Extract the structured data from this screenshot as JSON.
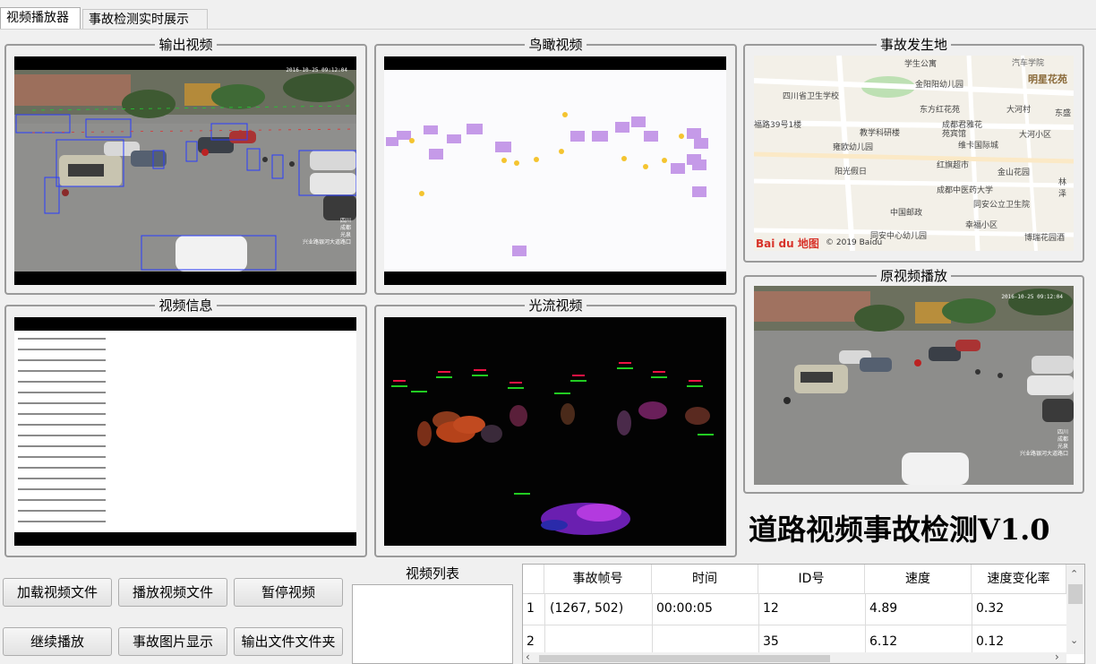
{
  "tabs": [
    {
      "label": "视频播放器",
      "active": true
    },
    {
      "label": "事故检测实时展示",
      "active": false
    }
  ],
  "panels": {
    "output_video": "输出视频",
    "birdseye_video": "鸟瞰视频",
    "accident_location": "事故发生地",
    "video_info": "视频信息",
    "optical_flow": "光流视频",
    "original_video": "原视频播放"
  },
  "frame_overlay": {
    "timestamp": "2016-10-25 09:12:04",
    "location_lines": [
      "四川",
      "成都",
      "光泉",
      "兴业路银河大道路口"
    ]
  },
  "map": {
    "labels": [
      "学生公寓",
      "汽车学院",
      "明星花苑",
      "金阳阳幼儿园",
      "四川省卫生学校",
      "东方红花苑",
      "大河村",
      "东盛",
      "成都君雅花苑宾馆",
      "福路39号1楼",
      "教学科研楼",
      "大河小区",
      "雍欧幼儿园",
      "维卡国际城",
      "阳光假日",
      "红旗超市",
      "金山花园",
      "成都中医药大学",
      "林泽",
      "同安公立卫生院",
      "中国邮政",
      "幸福小区",
      "同安中心幼儿园",
      "博瑞花园酒"
    ],
    "logo": "Bai du 地图",
    "copyright": "© 2019 Baidu"
  },
  "app_title": "道路视频事故检测V1.0",
  "buttons": {
    "load_video": "加载视频文件",
    "play_video": "播放视频文件",
    "pause_video": "暂停视频",
    "resume": "继续播放",
    "show_accident_image": "事故图片显示",
    "output_folder": "输出文件文件夹"
  },
  "video_list": {
    "label": "视频列表",
    "items": []
  },
  "accident_table": {
    "columns": [
      "事故帧号",
      "时间",
      "ID号",
      "速度",
      "速度变化率"
    ],
    "rows": [
      {
        "index": "1",
        "frame": "(1267, 502)",
        "time": "00:00:05",
        "id": "12",
        "speed": "4.89",
        "rate": "0.32"
      },
      {
        "index": "2",
        "frame": "",
        "time": "",
        "id": "35",
        "speed": "6.12",
        "rate": "0.12"
      }
    ]
  }
}
